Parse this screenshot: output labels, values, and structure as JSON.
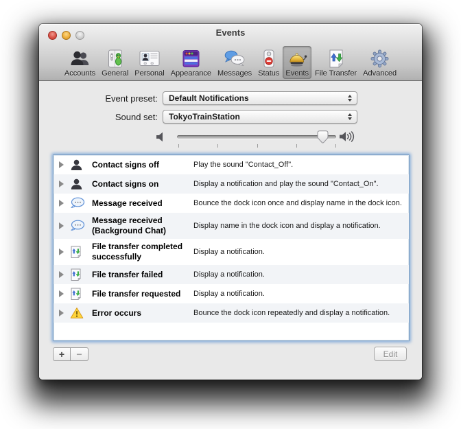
{
  "window": {
    "title": "Events",
    "traffic_lights": [
      "close",
      "minimize",
      "zoom"
    ]
  },
  "toolbar": {
    "selected_item": "Events",
    "items": [
      {
        "label": "Accounts",
        "icon": "accounts-icon"
      },
      {
        "label": "General",
        "icon": "general-icon"
      },
      {
        "label": "Personal",
        "icon": "personal-icon"
      },
      {
        "label": "Appearance",
        "icon": "appearance-icon"
      },
      {
        "label": "Messages",
        "icon": "messages-icon"
      },
      {
        "label": "Status",
        "icon": "status-icon"
      },
      {
        "label": "Events",
        "icon": "events-bell-icon",
        "selected": true
      },
      {
        "label": "File Transfer",
        "icon": "file-transfer-icon"
      },
      {
        "label": "Advanced",
        "icon": "advanced-gear-icon"
      }
    ]
  },
  "form": {
    "event_preset": {
      "label": "Event preset:",
      "value": "Default Notifications"
    },
    "sound_set": {
      "label": "Sound set:",
      "value": "TokyoTrainStation"
    },
    "volume": {
      "level_percent": 92,
      "tick_count": 5,
      "left_icon": "speaker-min-icon",
      "right_icon": "speaker-max-icon"
    }
  },
  "event_list": {
    "rows": [
      {
        "icon": "person-icon",
        "title": "Contact signs off",
        "description": "Play the sound \"Contact_Off\"."
      },
      {
        "icon": "person-icon",
        "title": "Contact signs on",
        "description": "Display a notification and play the sound \"Contact_On\"."
      },
      {
        "icon": "chat-bubble-icon",
        "title": "Message received",
        "description": "Bounce the dock icon once and display name in the dock icon."
      },
      {
        "icon": "chat-bubble-icon",
        "title": "Message received (Background Chat)",
        "description": "Display name in the dock icon and display a notification."
      },
      {
        "icon": "file-transfer-icon",
        "title": "File transfer completed successfully",
        "description": "Display a notification."
      },
      {
        "icon": "file-transfer-icon",
        "title": "File transfer failed",
        "description": "Display a notification."
      },
      {
        "icon": "file-transfer-icon",
        "title": "File transfer requested",
        "description": "Display a notification."
      },
      {
        "icon": "warning-icon",
        "title": "Error occurs",
        "description": "Bounce the dock icon repeatedly and display a notification."
      }
    ]
  },
  "footer": {
    "add_label": "+",
    "remove_label": "−",
    "edit_label": "Edit",
    "edit_enabled": false
  },
  "colors": {
    "window_bg": "#e9e9e9",
    "focus_ring_blue": "#7da0c4",
    "toolbar_selected_bg": "rgba(0,0,0,0.16)",
    "bell_gold": "#e6b63c",
    "warning_yellow": "#ffd43a",
    "stripe_row": "#f2f4f7"
  }
}
